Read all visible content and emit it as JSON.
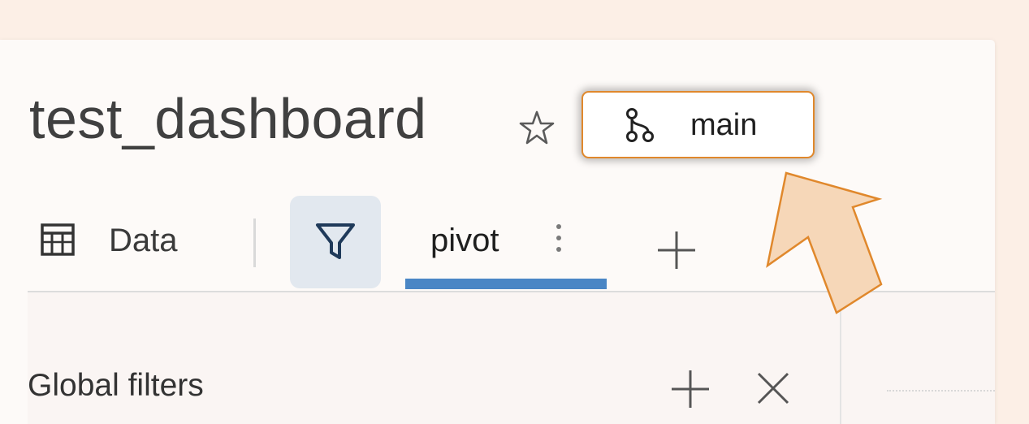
{
  "dashboard": {
    "title": "test_dashboard",
    "branch_label": "main"
  },
  "tabs": {
    "data_label": "Data",
    "active_tab_label": "pivot"
  },
  "filters": {
    "global_filters_label": "Global filters"
  },
  "icons": {
    "favorite": "star-icon",
    "branch": "git-branch-icon",
    "data": "table-icon",
    "filter": "filter-icon",
    "tab_menu": "kebab-menu-icon",
    "add_tab": "plus-icon",
    "add_filter": "plus-icon",
    "close_filters": "close-icon",
    "annotation": "arrow-icon"
  },
  "colors": {
    "page_background": "#fcefe6",
    "branch_border": "#e0882c",
    "active_tab": "#4a86c5",
    "filter_button_bg": "#e2e8ef",
    "annotation_arrow_fill": "#f6d7b8",
    "annotation_arrow_stroke": "#e0882c"
  }
}
